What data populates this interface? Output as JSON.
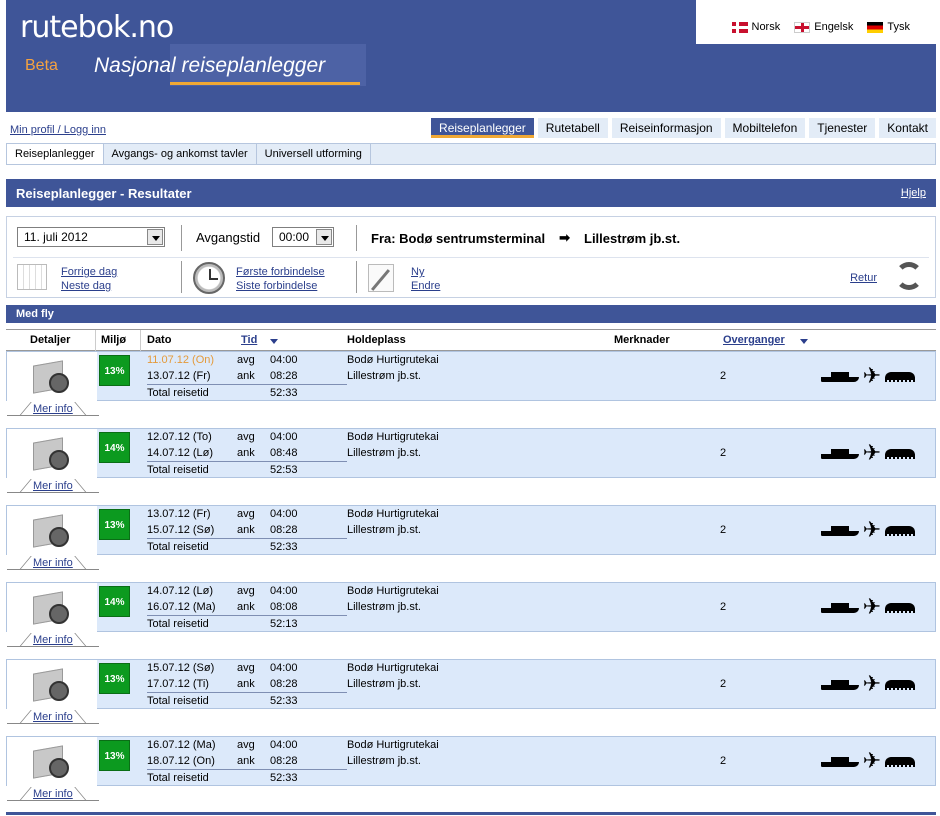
{
  "brand": {
    "logo": "rutebok.no",
    "beta": "Beta",
    "tagline": "Nasjonal reiseplanlegger"
  },
  "languages": [
    {
      "label": "Norsk",
      "flag": "norway-flag-icon"
    },
    {
      "label": "Engelsk",
      "flag": "uk-flag-icon"
    },
    {
      "label": "Tysk",
      "flag": "germany-flag-icon"
    }
  ],
  "profile_link": "Min profil / Logg inn",
  "main_nav": [
    "Reiseplanlegger",
    "Rutetabell",
    "Reiseinformasjon",
    "Mobiltelefon",
    "Tjenester",
    "Kontakt"
  ],
  "main_nav_active": "Reiseplanlegger",
  "sub_nav": [
    "Reiseplanlegger",
    "Avgangs- og ankomst tavler",
    "Universell utforming"
  ],
  "page_title": "Reiseplanlegger - Resultater",
  "help": "Hjelp",
  "search": {
    "date": "11. juli 2012",
    "time_label": "Avgangstid",
    "time": "00:00",
    "from": "Fra: Bodø sentrumsterminal",
    "to": "Lillestrøm jb.st.",
    "prev_day": "Forrige dag",
    "next_day": "Neste dag",
    "first_conn": "Første forbindelse",
    "last_conn": "Siste forbindelse",
    "new": "Ny",
    "edit": "Endre",
    "back": "Retur"
  },
  "section": "Med fly",
  "columns": {
    "details": "Detaljer",
    "eco": "Miljø",
    "date": "Dato",
    "time": "Tid",
    "stop": "Holdeplass",
    "notes": "Merknader",
    "transfers": "Overganger"
  },
  "labels": {
    "dep": "avg",
    "arr": "ank",
    "total": "Total reisetid",
    "more": "Mer info"
  },
  "results": [
    {
      "eco": "13%",
      "date_dep": "11.07.12 (On)",
      "date_arr": "13.07.12 (Fr)",
      "t_dep": "04:00",
      "t_arr": "08:28",
      "total": "52:33",
      "stop_dep": "Bodø Hurtigrutekai",
      "stop_arr": "Lillestrøm jb.st.",
      "transfers": "2"
    },
    {
      "eco": "14%",
      "date_dep": "12.07.12 (To)",
      "date_arr": "14.07.12 (Lø)",
      "t_dep": "04:00",
      "t_arr": "08:48",
      "total": "52:53",
      "stop_dep": "Bodø Hurtigrutekai",
      "stop_arr": "Lillestrøm jb.st.",
      "transfers": "2"
    },
    {
      "eco": "13%",
      "date_dep": "13.07.12 (Fr)",
      "date_arr": "15.07.12 (Sø)",
      "t_dep": "04:00",
      "t_arr": "08:28",
      "total": "52:33",
      "stop_dep": "Bodø Hurtigrutekai",
      "stop_arr": "Lillestrøm jb.st.",
      "transfers": "2"
    },
    {
      "eco": "14%",
      "date_dep": "14.07.12 (Lø)",
      "date_arr": "16.07.12 (Ma)",
      "t_dep": "04:00",
      "t_arr": "08:08",
      "total": "52:13",
      "stop_dep": "Bodø Hurtigrutekai",
      "stop_arr": "Lillestrøm jb.st.",
      "transfers": "2"
    },
    {
      "eco": "13%",
      "date_dep": "15.07.12 (Sø)",
      "date_arr": "17.07.12 (Ti)",
      "t_dep": "04:00",
      "t_arr": "08:28",
      "total": "52:33",
      "stop_dep": "Bodø Hurtigrutekai",
      "stop_arr": "Lillestrøm jb.st.",
      "transfers": "2"
    },
    {
      "eco": "13%",
      "date_dep": "16.07.12 (Ma)",
      "date_arr": "18.07.12 (On)",
      "t_dep": "04:00",
      "t_arr": "08:28",
      "total": "52:33",
      "stop_dep": "Bodø Hurtigrutekai",
      "stop_arr": "Lillestrøm jb.st.",
      "transfers": "2"
    }
  ],
  "colors": {
    "brand_blue": "#3f5598",
    "accent_orange": "#f0a834",
    "row_bg": "#dce9fa",
    "eco_green": "#0c9a1f"
  }
}
